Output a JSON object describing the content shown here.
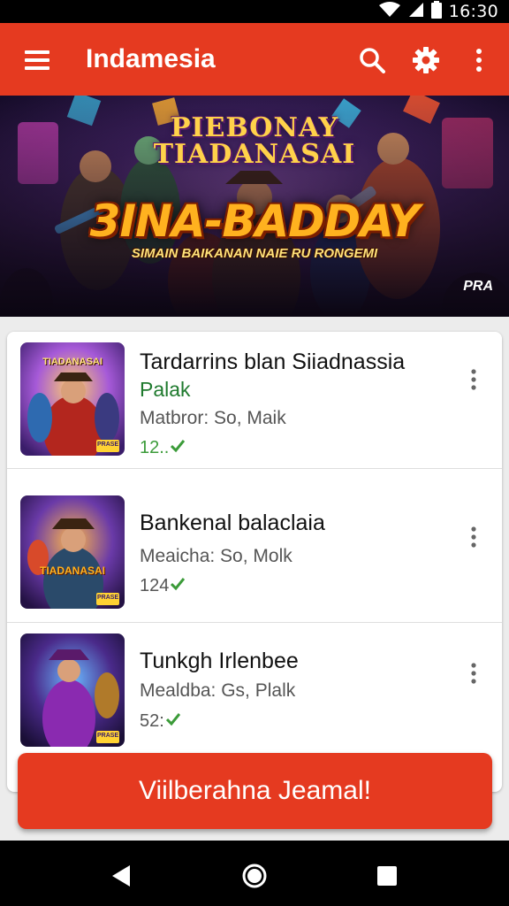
{
  "status_bar": {
    "time": "16:30",
    "icons": [
      "wifi-icon",
      "signal-icon",
      "battery-icon"
    ]
  },
  "app_bar": {
    "title": "Indamesia",
    "icons": [
      "menu-icon",
      "search-icon",
      "gear-icon",
      "more-vert-icon"
    ],
    "color": "#e53a20"
  },
  "banner": {
    "title_line1": "PIEBONAY",
    "title_line2": "TIADANASAI",
    "main_text": "3INA-BADDAY",
    "sub_text": "SIMAIN BAIKANAN NAIE RU RONGEMI",
    "badge": "PRA"
  },
  "list": {
    "items": [
      {
        "title": "Tardarrins blan Siiadnassia",
        "subtitle": "Palak",
        "meta": "Matbror: So, Maik",
        "rating": "12..",
        "thumb_label_top": "TIADANASAI",
        "thumb_badge": "PRASE"
      },
      {
        "title": "Bankenal balaclaia",
        "subtitle": "",
        "meta": "Meaicha: So, Molk",
        "rating": "124",
        "thumb_label_top": "TIADANASAI",
        "thumb_badge": "PRASE"
      },
      {
        "title": "Tunkgh Irlenbee",
        "subtitle": "",
        "meta": "Mealdba: Gs, Plalk",
        "rating": "52:",
        "thumb_label_top": "",
        "thumb_badge": "PRASE"
      }
    ]
  },
  "cta": {
    "label": "Viilberahna Jeamal!",
    "color": "#e53a20"
  },
  "nav_bar": {
    "icons": [
      "back-icon",
      "home-icon",
      "recents-icon"
    ]
  }
}
